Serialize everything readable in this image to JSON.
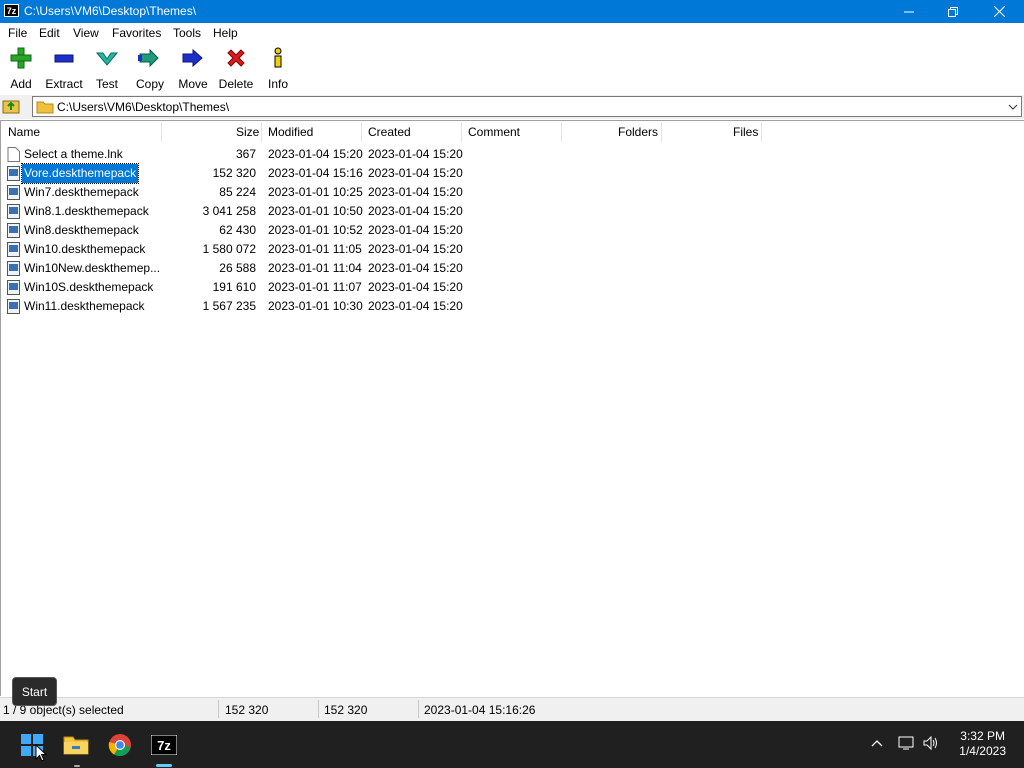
{
  "window": {
    "title": "C:\\Users\\VM6\\Desktop\\Themes\\",
    "app_icon_text": "7z"
  },
  "menu": [
    "File",
    "Edit",
    "View",
    "Favorites",
    "Tools",
    "Help"
  ],
  "toolbar": [
    {
      "label": "Add",
      "icon": "plus-icon",
      "color": "#2aa52a"
    },
    {
      "label": "Extract",
      "icon": "minus-icon",
      "color": "#1d2fc8"
    },
    {
      "label": "Test",
      "icon": "check-arrow-icon",
      "color": "#1fb8a0"
    },
    {
      "label": "Copy",
      "icon": "double-arrow-icon",
      "color": "#1f9a7a"
    },
    {
      "label": "Move",
      "icon": "arrow-right-icon",
      "color": "#1d2fc8"
    },
    {
      "label": "Delete",
      "icon": "x-icon",
      "color": "#d81b1b"
    },
    {
      "label": "Info",
      "icon": "info-icon",
      "color": "#c8a000"
    }
  ],
  "address": {
    "path": "C:\\Users\\VM6\\Desktop\\Themes\\"
  },
  "columns": [
    "Name",
    "Size",
    "Modified",
    "Created",
    "Comment",
    "Folders",
    "Files"
  ],
  "files": [
    {
      "name": "Select a theme.lnk",
      "size": "367",
      "modified": "2023-01-04 15:20",
      "created": "2023-01-04 15:20",
      "selected": false
    },
    {
      "name": "Vore.deskthemepack",
      "size": "152 320",
      "modified": "2023-01-04 15:16",
      "created": "2023-01-04 15:20",
      "selected": true
    },
    {
      "name": "Win7.deskthemepack",
      "size": "85 224",
      "modified": "2023-01-01 10:25",
      "created": "2023-01-04 15:20",
      "selected": false
    },
    {
      "name": "Win8.1.deskthemepack",
      "size": "3 041 258",
      "modified": "2023-01-01 10:50",
      "created": "2023-01-04 15:20",
      "selected": false
    },
    {
      "name": "Win8.deskthemepack",
      "size": "62 430",
      "modified": "2023-01-01 10:52",
      "created": "2023-01-04 15:20",
      "selected": false
    },
    {
      "name": "Win10.deskthemepack",
      "size": "1 580 072",
      "modified": "2023-01-01 11:05",
      "created": "2023-01-04 15:20",
      "selected": false
    },
    {
      "name": "Win10New.deskthemep...",
      "size": "26 588",
      "modified": "2023-01-01 11:04",
      "created": "2023-01-04 15:20",
      "selected": false
    },
    {
      "name": "Win10S.deskthemepack",
      "size": "191 610",
      "modified": "2023-01-01 11:07",
      "created": "2023-01-04 15:20",
      "selected": false
    },
    {
      "name": "Win11.deskthemepack",
      "size": "1 567 235",
      "modified": "2023-01-01 10:30",
      "created": "2023-01-04 15:20",
      "selected": false
    }
  ],
  "status": {
    "selection": "1 / 9 object(s) selected",
    "size": "152 320",
    "packed": "152 320",
    "modified": "2023-01-04 15:16:26"
  },
  "tooltip": "Start",
  "taskbar": {
    "time": "3:32 PM",
    "date": "1/4/2023",
    "apps": [
      "start-icon",
      "file-explorer-icon",
      "chrome-icon",
      "7zip-icon"
    ]
  },
  "colors": {
    "accent": "#0078d7",
    "taskbar": "#202020"
  }
}
